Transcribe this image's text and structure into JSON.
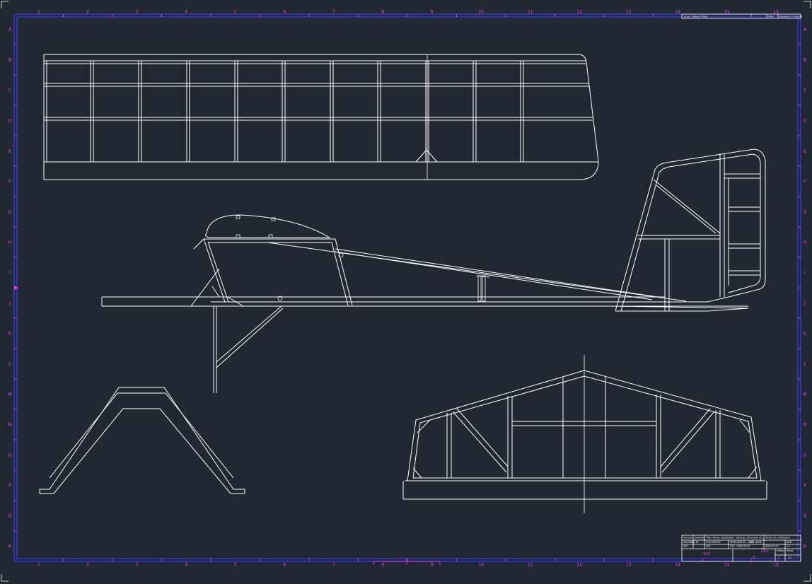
{
  "sheet": {
    "colors": {
      "background": "#222831",
      "frame": "#3a3cff",
      "zone_marks": "#ff40ff",
      "geometry": "#ffffff"
    },
    "zones": {
      "columns": [
        "1",
        "2",
        "3",
        "4",
        "5",
        "6",
        "7",
        "8",
        "9",
        "10",
        "11",
        "12",
        "13",
        "14",
        "15",
        "16"
      ],
      "rows": [
        "A",
        "B",
        "C",
        "D",
        "E",
        "F",
        "G",
        "H",
        "I",
        "J",
        "K",
        "L",
        "M",
        "N",
        "O",
        "P",
        "Q",
        "R"
      ]
    }
  },
  "title_block_top": {
    "scale_label": "Scale",
    "scale_value": "Emblem scale",
    "date_label": "Date",
    "signature_label": "Signature / Checked"
  },
  "title_block": {
    "c1": "General",
    "c2": "Quantity",
    "c3": "Title / Name, designation, material, dimension etc",
    "c4": "Article No / Reference",
    "r1a": "DESIGNED BY",
    "r1b": "CHECKED BY",
    "r1c": "APPROVED BY - DATE",
    "r1d": "FILE NAME",
    "r1e": "DATE",
    "r1f": "SCALE",
    "r2a": "XXX",
    "r2b": "XXX",
    "r2c": "XXX - 0000-00-00",
    "r2d": "XXX",
    "r2e": "0000-00-00",
    "r2f": "1:1",
    "company": "XXX",
    "title_mag": "XXX",
    "x_mark": "X",
    "edition_label": "Edition",
    "sheet_label": "Sheet",
    "edition_value": "1",
    "sheet_value": "1/1"
  }
}
